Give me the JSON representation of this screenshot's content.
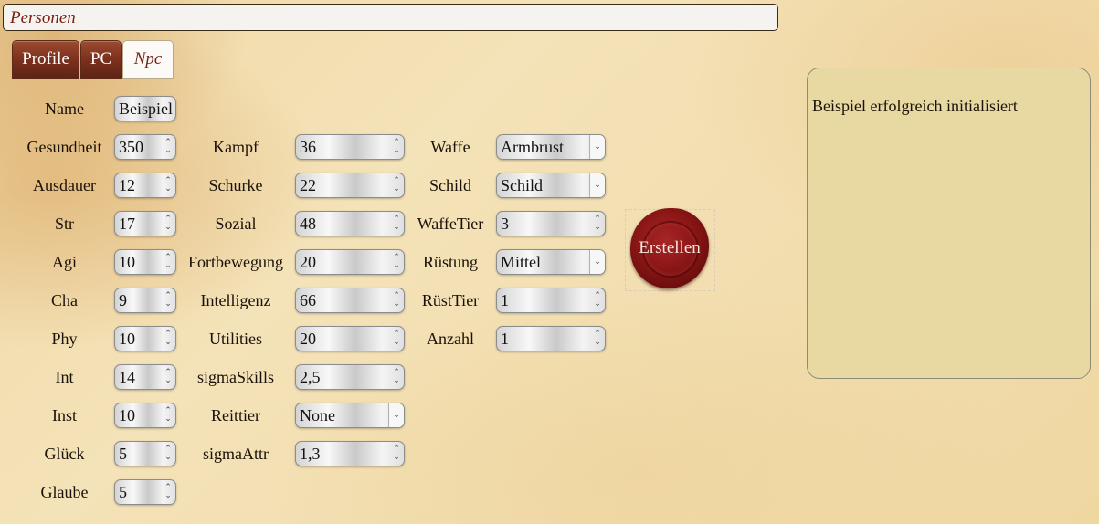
{
  "header": {
    "title": "Personen"
  },
  "tabs": [
    {
      "label": "Profile"
    },
    {
      "label": "PC"
    },
    {
      "label": "Npc"
    }
  ],
  "form": {
    "name": {
      "label": "Name",
      "value": "Beispiel"
    },
    "col1": [
      {
        "label": "Gesundheit",
        "value": "350"
      },
      {
        "label": "Ausdauer",
        "value": "12"
      },
      {
        "label": "Str",
        "value": "17"
      },
      {
        "label": "Agi",
        "value": "10"
      },
      {
        "label": "Cha",
        "value": "9"
      },
      {
        "label": "Phy",
        "value": "10"
      },
      {
        "label": "Int",
        "value": "14"
      },
      {
        "label": "Inst",
        "value": "10"
      },
      {
        "label": "Glück",
        "value": "5"
      },
      {
        "label": "Glaube",
        "value": "5"
      }
    ],
    "col2": [
      {
        "label": "Kampf",
        "value": "36"
      },
      {
        "label": "Schurke",
        "value": "22"
      },
      {
        "label": "Sozial",
        "value": "48"
      },
      {
        "label": "Fortbewegung",
        "value": "20"
      },
      {
        "label": "Intelligenz",
        "value": "66"
      },
      {
        "label": "Utilities",
        "value": "20"
      },
      {
        "label": "sigmaSkills",
        "value": "2,5"
      },
      {
        "label": "Reittier",
        "value": "None"
      },
      {
        "label": "sigmaAttr",
        "value": "1,3"
      }
    ],
    "col3": [
      {
        "label": "Waffe",
        "value": "Armbrust"
      },
      {
        "label": "Schild",
        "value": "Schild"
      },
      {
        "label": "WaffeTier",
        "value": "3"
      },
      {
        "label": "Rüstung",
        "value": "Mittel"
      },
      {
        "label": "RüstTier",
        "value": "1"
      },
      {
        "label": "Anzahl",
        "value": "1"
      }
    ]
  },
  "create_button": {
    "label": "Erstellen"
  },
  "output": {
    "message": "Beispiel erfolgreich initialisiert"
  }
}
